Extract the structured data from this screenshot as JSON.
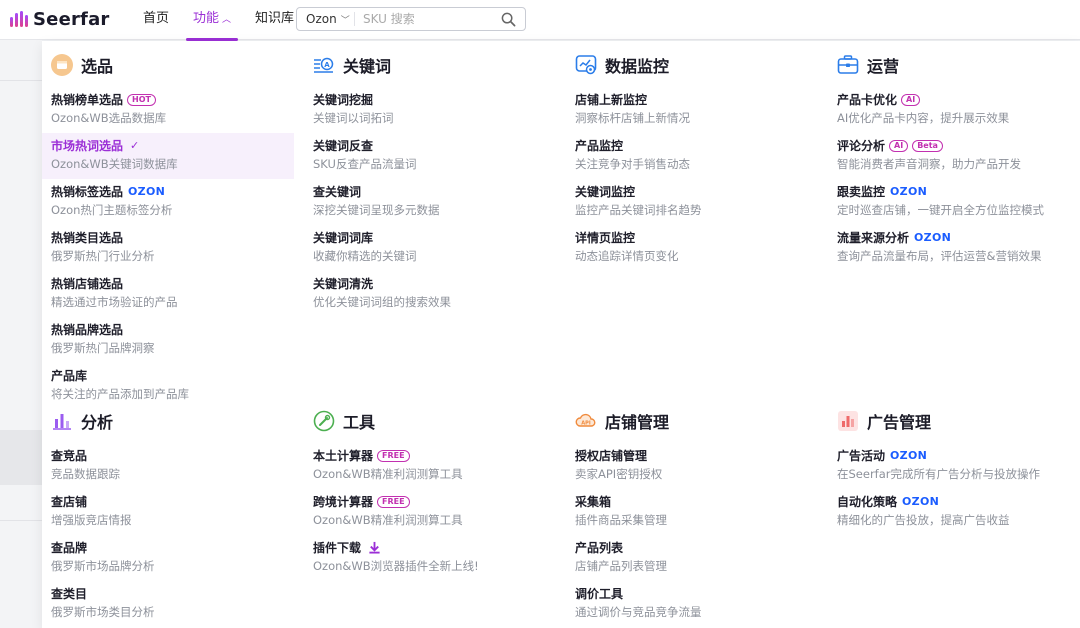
{
  "header": {
    "logo_text": "Seerfar",
    "nav": [
      {
        "label": "首页"
      },
      {
        "label": "功能"
      },
      {
        "label": "知识库"
      }
    ],
    "search": {
      "platform": "Ozon",
      "placeholder": "SKU 搜索"
    }
  },
  "colors": {
    "accent": "#9b2fd6",
    "ozon_blue": "#1a5cff",
    "badge": "#c230b0"
  },
  "sections": {
    "xuanpin": {
      "title": "选品",
      "items": [
        {
          "title": "热销榜单选品",
          "badge": "HOT",
          "desc": "Ozon&WB选品数据库"
        },
        {
          "title": "市场热词选品",
          "desc": "Ozon&WB关键词数据库"
        },
        {
          "title": "热销标签选品",
          "brand": "OZON",
          "desc": "Ozon热门主题标签分析"
        },
        {
          "title": "热销类目选品",
          "desc": "俄罗斯热门行业分析"
        },
        {
          "title": "热销店铺选品",
          "desc": "精选通过市场验证的产品"
        },
        {
          "title": "热销品牌选品",
          "desc": "俄罗斯热门品牌洞察"
        },
        {
          "title": "产品库",
          "desc": "将关注的产品添加到产品库"
        }
      ]
    },
    "keyword": {
      "title": "关键词",
      "items": [
        {
          "title": "关键词挖掘",
          "desc": "关键词以词拓词"
        },
        {
          "title": "关键词反查",
          "desc": "SKU反查产品流量词"
        },
        {
          "title": "查关键词",
          "desc": "深挖关键词呈现多元数据"
        },
        {
          "title": "关键词词库",
          "desc": "收藏你精选的关键词"
        },
        {
          "title": "关键词清洗",
          "desc": "优化关键词词组的搜索效果"
        }
      ]
    },
    "monitor": {
      "title": "数据监控",
      "items": [
        {
          "title": "店铺上新监控",
          "desc": "洞察标杆店铺上新情况"
        },
        {
          "title": "产品监控",
          "desc": "关注竞争对手销售动态"
        },
        {
          "title": "关键词监控",
          "desc": "监控产品关键词排名趋势"
        },
        {
          "title": "详情页监控",
          "desc": "动态追踪详情页变化"
        }
      ]
    },
    "operation": {
      "title": "运营",
      "items": [
        {
          "title": "产品卡优化",
          "badge": "AI",
          "desc": "AI优化产品卡内容，提升展示效果"
        },
        {
          "title": "评论分析",
          "badge": "AI",
          "badge2": "Beta",
          "desc": "智能消费者声音洞察，助力产品开发"
        },
        {
          "title": "跟卖监控",
          "brand": "OZON",
          "desc": "定时巡查店铺，一键开启全方位监控模式"
        },
        {
          "title": "流量来源分析",
          "brand": "OZON",
          "desc": "查询产品流量布局，评估运营&营销效果"
        }
      ]
    },
    "analysis": {
      "title": "分析",
      "items": [
        {
          "title": "查竞品",
          "desc": "竞品数据跟踪"
        },
        {
          "title": "查店铺",
          "desc": "增强版竞店情报"
        },
        {
          "title": "查品牌",
          "desc": "俄罗斯市场品牌分析"
        },
        {
          "title": "查类目",
          "desc": "俄罗斯市场类目分析"
        }
      ]
    },
    "tools": {
      "title": "工具",
      "items": [
        {
          "title": "本土计算器",
          "badge": "FREE",
          "desc": "Ozon&WB精准利润测算工具"
        },
        {
          "title": "跨境计算器",
          "badge": "FREE",
          "desc": "Ozon&WB精准利润测算工具"
        },
        {
          "title": "插件下载",
          "desc": "Ozon&WB浏览器插件全新上线!"
        }
      ]
    },
    "store": {
      "title": "店铺管理",
      "items": [
        {
          "title": "授权店铺管理",
          "desc": "卖家API密钥授权"
        },
        {
          "title": "采集箱",
          "desc": "插件商品采集管理"
        },
        {
          "title": "产品列表",
          "desc": "店铺产品列表管理"
        },
        {
          "title": "调价工具",
          "desc": "通过调价与竞品竞争流量"
        }
      ]
    },
    "ads": {
      "title": "广告管理",
      "items": [
        {
          "title": "广告活动",
          "brand": "OZON",
          "desc": "在Seerfar完成所有广告分析与投放操作"
        },
        {
          "title": "自动化策略",
          "brand": "OZON",
          "desc": "精细化的广告投放，提高广告收益"
        }
      ]
    }
  }
}
